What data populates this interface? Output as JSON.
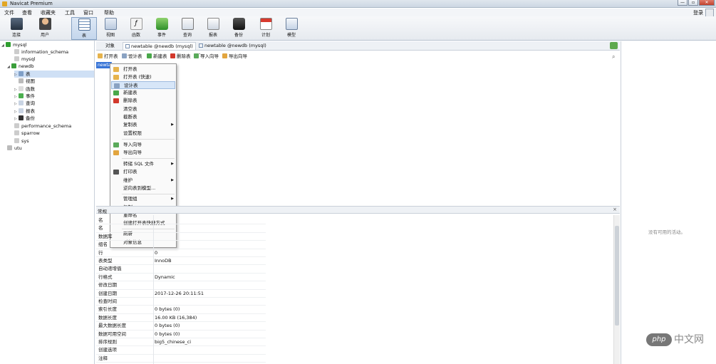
{
  "window": {
    "title": "Navicat Premium",
    "btn_min": "—",
    "btn_max": "▫",
    "btn_close": "✕"
  },
  "menubar": [
    "文件",
    "查看",
    "收藏夹",
    "工具",
    "窗口",
    "帮助"
  ],
  "login": "登录",
  "toolbar": [
    "连接",
    "用户",
    "表",
    "视图",
    "函数",
    "事件",
    "查询",
    "报表",
    "备份",
    "计划",
    "模型"
  ],
  "tree": {
    "mysql_conn": "mysql",
    "information_schema": "information_schema",
    "mysql_db": "mysql",
    "newdb": "newdb",
    "tables": "表",
    "views": "视图",
    "functions": "函数",
    "events": "事件",
    "queries": "查询",
    "reports": "报表",
    "backups": "备份",
    "performance_schema": "performance_schema",
    "sparrow": "sparrow",
    "sys": "sys",
    "utu": "utu"
  },
  "object_tabs": {
    "objects": "对象",
    "tab1": "newtable @newdb (mysql) -...",
    "tab2": "newtable @newdb (mysql) -..."
  },
  "actions": [
    "打开表",
    "设计表",
    "新建表",
    "删除表",
    "导入向导",
    "导出向导"
  ],
  "selected_table": "newtable",
  "context_menu": [
    {
      "label": "打开表",
      "sub": false
    },
    {
      "label": "打开表 (快速)",
      "sub": false
    },
    {
      "label": "设计表",
      "sub": false
    },
    {
      "label": "新建表",
      "sub": false
    },
    {
      "label": "删除表",
      "sub": false
    },
    {
      "label": "清空表",
      "sub": false
    },
    {
      "label": "截断表",
      "sub": false
    },
    {
      "label": "复制表",
      "sub": true
    },
    {
      "label": "设置权限",
      "sub": false
    },
    {
      "label": "导入向导",
      "sub": false
    },
    {
      "label": "导出向导",
      "sub": false
    },
    {
      "label": "转储 SQL 文件",
      "sub": true
    },
    {
      "label": "打印表",
      "sub": false
    },
    {
      "label": "维护",
      "sub": true
    },
    {
      "label": "逆向表到模型...",
      "sub": false
    },
    {
      "label": "管理组",
      "sub": true
    },
    {
      "label": "复制",
      "sub": false
    },
    {
      "label": "重命名",
      "sub": false
    },
    {
      "label": "创建打开表快捷方式...",
      "sub": false
    },
    {
      "label": "刷新",
      "sub": false
    },
    {
      "label": "对象信息",
      "sub": false
    }
  ],
  "props_tab": "常规",
  "props": [
    {
      "k": "名",
      "v": ""
    },
    {
      "k": "名",
      "v": ""
    },
    {
      "k": "数据库",
      "v": ""
    },
    {
      "k": "组名",
      "v": ""
    },
    {
      "k": "行",
      "v": "0"
    },
    {
      "k": "表类型",
      "v": "InnoDB"
    },
    {
      "k": "自动递增值",
      "v": ""
    },
    {
      "k": "行格式",
      "v": "Dynamic"
    },
    {
      "k": "修改日期",
      "v": ""
    },
    {
      "k": "创建日期",
      "v": "2017-12-26 20:11:51"
    },
    {
      "k": "检查时间",
      "v": ""
    },
    {
      "k": "索引长度",
      "v": "0 bytes (0)"
    },
    {
      "k": "数据长度",
      "v": "16.00 KB (16,384)"
    },
    {
      "k": "最大数据长度",
      "v": "0 bytes (0)"
    },
    {
      "k": "数据可用空间",
      "v": "0 bytes (0)"
    },
    {
      "k": "排序规则",
      "v": "big5_chinese_ci"
    },
    {
      "k": "创建选项",
      "v": ""
    },
    {
      "k": "注释",
      "v": ""
    }
  ],
  "right_panel_msg": "没有可用的活动。",
  "watermark": {
    "logo": "php",
    "text": "中文网"
  }
}
